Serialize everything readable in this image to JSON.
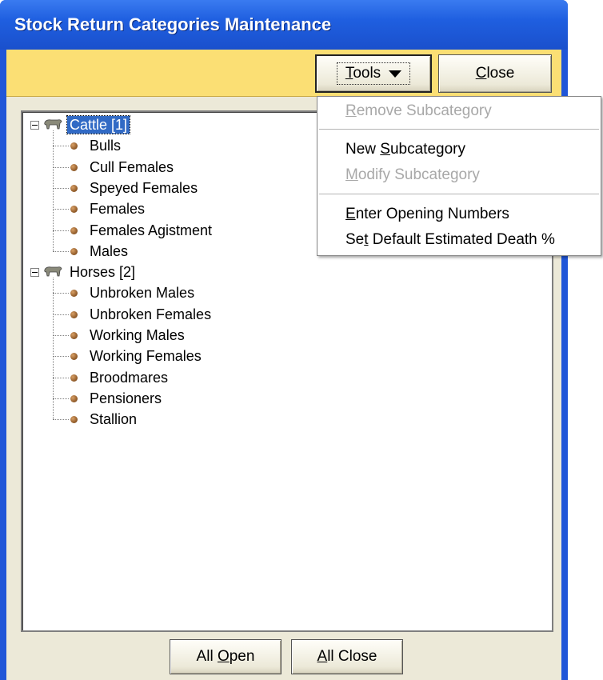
{
  "window": {
    "title": "Stock Return Categories Maintenance"
  },
  "toolbar": {
    "tools_pre": "",
    "tools_u": "T",
    "tools_post": "ools",
    "close_u": "C",
    "close_post": "lose"
  },
  "menu": {
    "items": [
      {
        "pre": "",
        "u": "R",
        "post": "emove Subcategory",
        "enabled": false
      },
      {
        "pre": "New ",
        "u": "S",
        "post": "ubcategory",
        "enabled": true
      },
      {
        "pre": "",
        "u": "M",
        "post": "odify Subcategory",
        "enabled": false
      },
      {
        "pre": "",
        "u": "E",
        "post": "nter Opening Numbers",
        "enabled": true
      },
      {
        "pre": "Se",
        "u": "t",
        "post": " Default Estimated Death %",
        "enabled": true
      }
    ]
  },
  "tree": {
    "categories": [
      {
        "label": "Cattle [1]",
        "selected": true,
        "expanded": true,
        "children": [
          "Bulls",
          "Cull Females",
          "Speyed Females",
          "Females",
          "Females Agistment",
          "Males"
        ]
      },
      {
        "label": "Horses [2]",
        "selected": false,
        "expanded": true,
        "children": [
          "Unbroken Males",
          "Unbroken Females",
          "Working Males",
          "Working Females",
          "Broodmares",
          "Pensioners",
          "Stallion"
        ]
      }
    ]
  },
  "footer": {
    "all_open_pre": "All ",
    "all_open_u": "O",
    "all_open_post": "pen",
    "all_close_u": "A",
    "all_close_post": "ll Close"
  },
  "icons": {
    "category": "animal-icon",
    "leaf": "bullet-icon",
    "dropdown": "caret-down-icon",
    "expander": "collapse-icon"
  },
  "colors": {
    "title_bar": "#1f5fe0",
    "toolbar": "#fbdf74",
    "selection": "#316ac5",
    "disabled_text": "#a8a8a8"
  }
}
